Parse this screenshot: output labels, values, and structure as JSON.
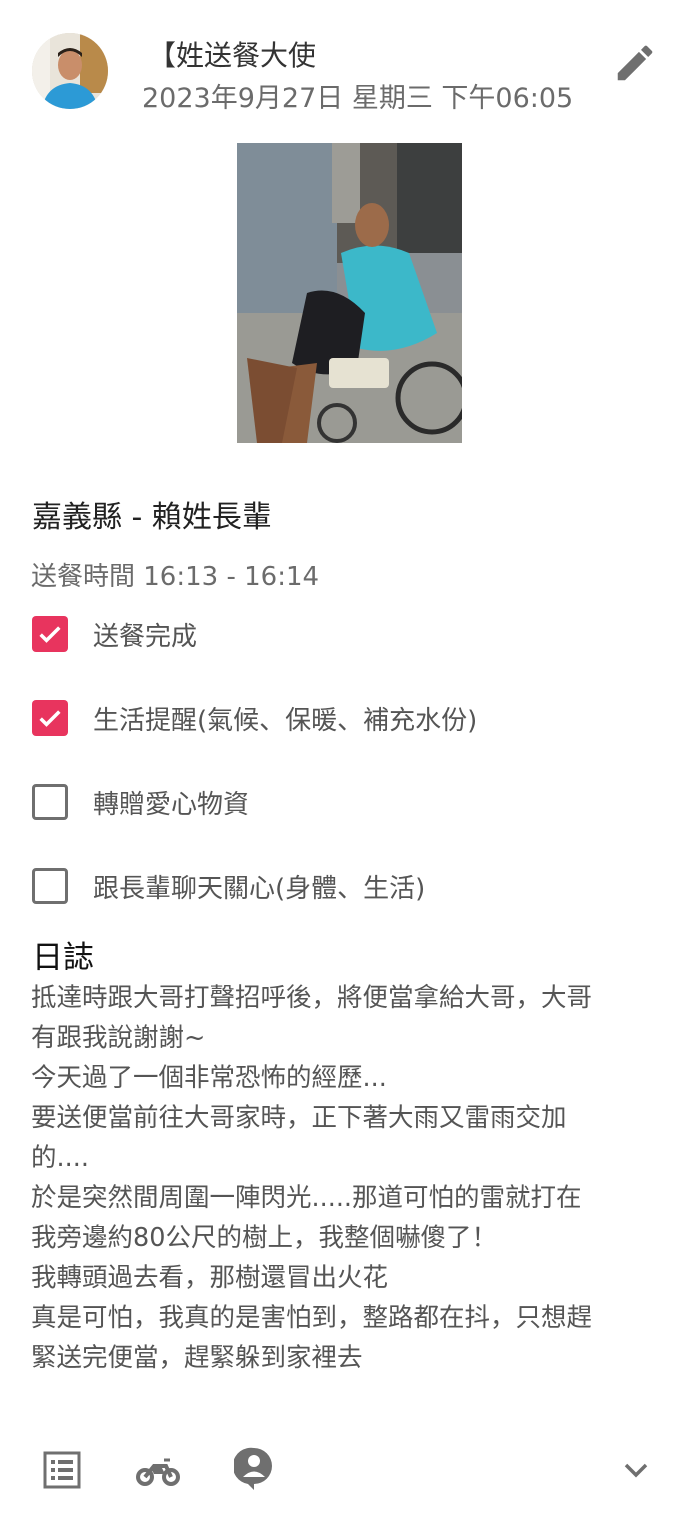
{
  "post": {
    "author": "【姓送餐大使",
    "timestamp": "2023年9月27日 星期三 下午06:05"
  },
  "record": {
    "location": "嘉義縣 - 賴姓長輩",
    "delivery_time": "送餐時間 16:13 - 16:14",
    "tasks": [
      {
        "label": "送餐完成",
        "checked": true
      },
      {
        "label": "生活提醒(氣候、保暖、補充水份)",
        "checked": true
      },
      {
        "label": "轉贈愛心物資",
        "checked": false
      },
      {
        "label": "跟長輩聊天關心(身體、生活)",
        "checked": false
      }
    ]
  },
  "log": {
    "title": "日誌",
    "lines": [
      "抵達時跟大哥打聲招呼後，將便當拿給大哥，大哥",
      "有跟我說謝謝~",
      "今天過了一個非常恐怖的經歷...",
      "要送便當前往大哥家時，正下著大雨又雷雨交加",
      "的....",
      "於是突然間周圍一陣閃光.....那道可怕的雷就打在",
      "我旁邊約80公尺的樹上，我整個嚇傻了！",
      "我轉頭過去看，那樹還冒出火花",
      "真是可怕，我真的是害怕到，整路都在抖，只想趕",
      "緊送完便當，趕緊躲到家裡去"
    ]
  },
  "colors": {
    "accent": "#e8345e",
    "icon_gray": "#6f6f6f"
  },
  "icons": {
    "edit": "pencil-icon",
    "list": "list-icon",
    "delivery": "motorcycle-icon",
    "profile": "person-pin-icon",
    "expand": "chevron-down-icon"
  }
}
